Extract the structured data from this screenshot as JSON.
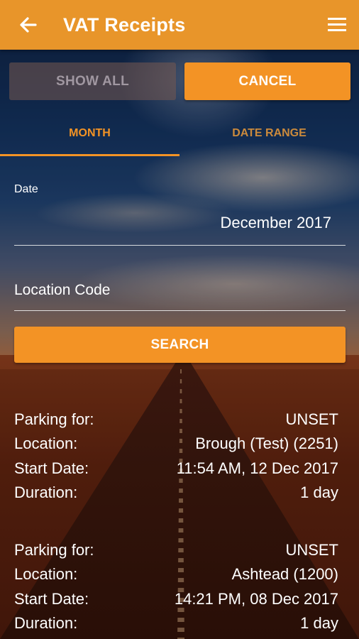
{
  "app_bar": {
    "title": "VAT Receipts",
    "back_icon": "arrow-left-icon",
    "menu_icon": "hamburger-menu-icon",
    "color": "#e8952a"
  },
  "actions": {
    "show_all_label": "SHOW ALL",
    "cancel_label": "CANCEL"
  },
  "tabs": [
    {
      "label": "MONTH",
      "selected": true
    },
    {
      "label": "DATE RANGE",
      "selected": false
    }
  ],
  "form": {
    "date_label": "Date",
    "date_value": "December 2017",
    "location_placeholder": "Location Code",
    "search_label": "SEARCH"
  },
  "receipts": [
    {
      "rows": [
        {
          "key": "Parking for:",
          "value": "UNSET"
        },
        {
          "key": "Location:",
          "value": "Brough (Test) (2251)"
        },
        {
          "key": "Start Date:",
          "value": "11:54 AM, 12 Dec 2017"
        },
        {
          "key": "Duration:",
          "value": "1 day"
        }
      ]
    },
    {
      "rows": [
        {
          "key": "Parking for:",
          "value": "UNSET"
        },
        {
          "key": "Location:",
          "value": "Ashtead (1200)"
        },
        {
          "key": "Start Date:",
          "value": "14:21 PM, 08 Dec 2017"
        },
        {
          "key": "Duration:",
          "value": "1 day"
        }
      ]
    }
  ],
  "colors": {
    "accent": "#f39325",
    "disabled_button": "#785a50"
  }
}
